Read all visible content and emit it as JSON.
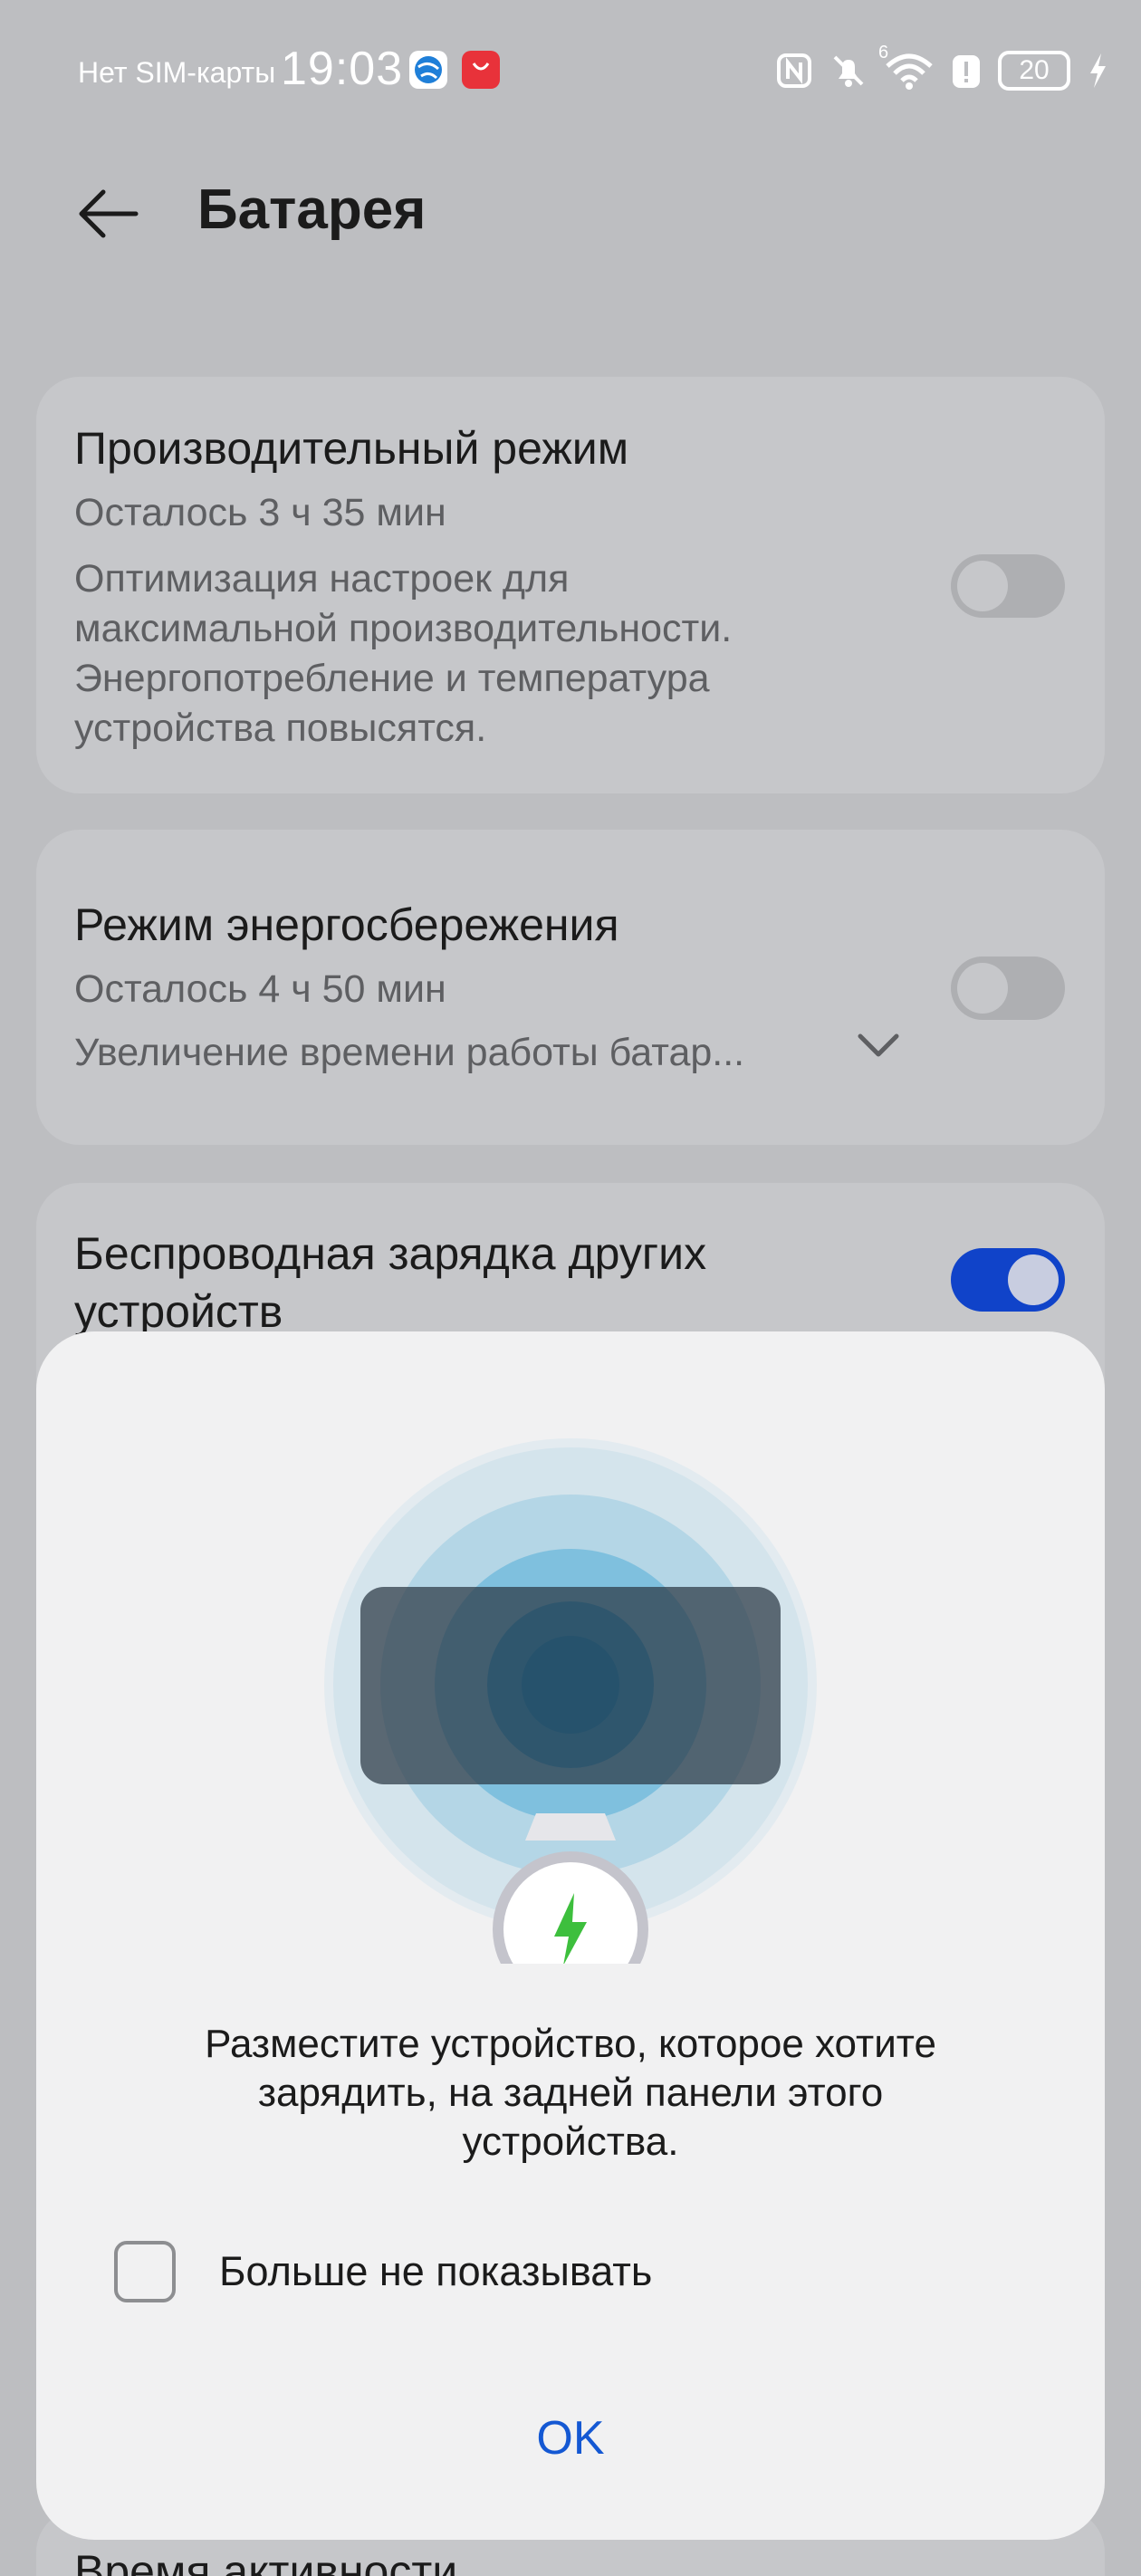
{
  "status_bar": {
    "carrier": "Нет SIM-карты",
    "time": "19:03",
    "network": "6",
    "battery_level": "20",
    "icons": [
      "nfc-icon",
      "mute-bell-icon",
      "wifi-icon",
      "alert-icon",
      "battery-icon",
      "charging-bolt-icon"
    ]
  },
  "header": {
    "title": "Батарея"
  },
  "cards": {
    "performance": {
      "title": "Производительный режим",
      "remaining": "Осталось 3 ч 35 мин",
      "description_lines": [
        "Оптимизация настроек для",
        "максимальной производительности.",
        "Энергопотребление и температура",
        "устройства повысятся."
      ],
      "toggle_on": false
    },
    "power_saving": {
      "title": "Режим энергосбережения",
      "remaining": "Осталось 4 ч 50 мин",
      "description": "Увеличение времени работы батар...",
      "toggle_on": false
    },
    "wireless_reverse": {
      "title_lines": [
        "Беспроводная зарядка других",
        "устройств"
      ],
      "toggle_on": true
    },
    "activity": {
      "title": "Время активности"
    }
  },
  "dialog": {
    "message_lines": [
      "Разместите устройство, которое хотите",
      "зарядить, на задней панели этого",
      "устройства."
    ],
    "checkbox_label": "Больше не показывать",
    "checkbox_checked": false,
    "ok_label": "OK"
  },
  "colors": {
    "accent": "#1458d3",
    "toggle_on": "#1043c9",
    "charge_green": "#3dbf3d"
  }
}
